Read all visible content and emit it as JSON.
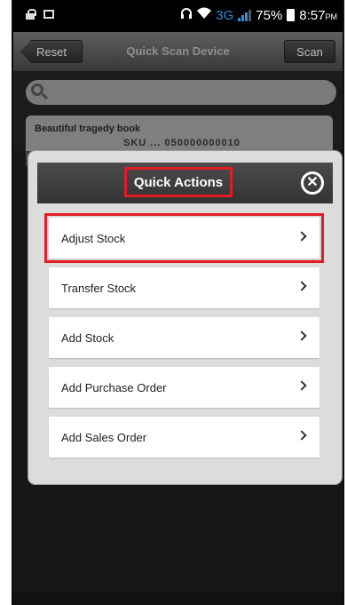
{
  "status_bar": {
    "network": "3G",
    "battery": "75%",
    "time": "8:57",
    "time_suffix": "PM",
    "icons": [
      "lock-icon",
      "image-icon",
      "headphones-icon",
      "wifi-icon",
      "signal-icon",
      "battery-icon"
    ]
  },
  "app_bar": {
    "reset_label": "Reset",
    "title": "Quick Scan Device",
    "scan_label": "Scan"
  },
  "search": {
    "placeholder": ""
  },
  "background_item": {
    "title": "Beautiful tragedy book",
    "subtitle": "SKU ... 050000000010"
  },
  "dialog": {
    "title": "Quick Actions",
    "close_icon": "close-circle-icon",
    "actions": [
      {
        "label": "Adjust Stock"
      },
      {
        "label": "Transfer Stock"
      },
      {
        "label": "Add Stock"
      },
      {
        "label": "Add Purchase Order"
      },
      {
        "label": "Add Sales Order"
      }
    ]
  },
  "colors": {
    "highlight": "#e11c24",
    "accent_network": "#2e8de0"
  }
}
